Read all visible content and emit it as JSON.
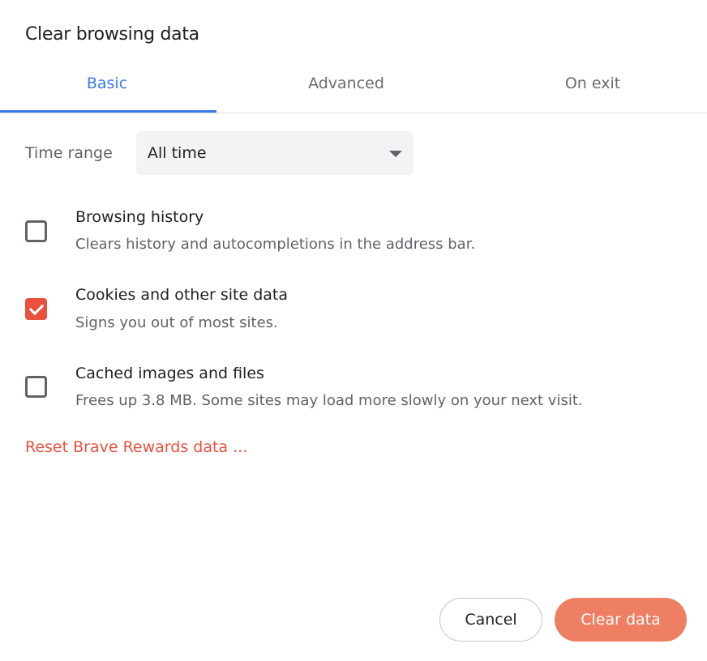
{
  "dialog": {
    "title": "Clear browsing data"
  },
  "tabs": [
    {
      "label": "Basic",
      "active": true
    },
    {
      "label": "Advanced",
      "active": false
    },
    {
      "label": "On exit",
      "active": false
    }
  ],
  "time_range": {
    "label": "Time range",
    "value": "All time"
  },
  "items": [
    {
      "title": "Browsing history",
      "description": "Clears history and autocompletions in the address bar.",
      "checked": false
    },
    {
      "title": "Cookies and other site data",
      "description": "Signs you out of most sites.",
      "checked": true
    },
    {
      "title": "Cached images and files",
      "description": "Frees up 3.8 MB. Some sites may load more slowly on your next visit.",
      "checked": false
    }
  ],
  "reset_link": "Reset Brave Rewards data ...",
  "buttons": {
    "cancel": "Cancel",
    "clear": "Clear data"
  },
  "colors": {
    "accent": "#3b78e7",
    "brand": "#e9513d",
    "primary_button": "#ee7f62"
  }
}
